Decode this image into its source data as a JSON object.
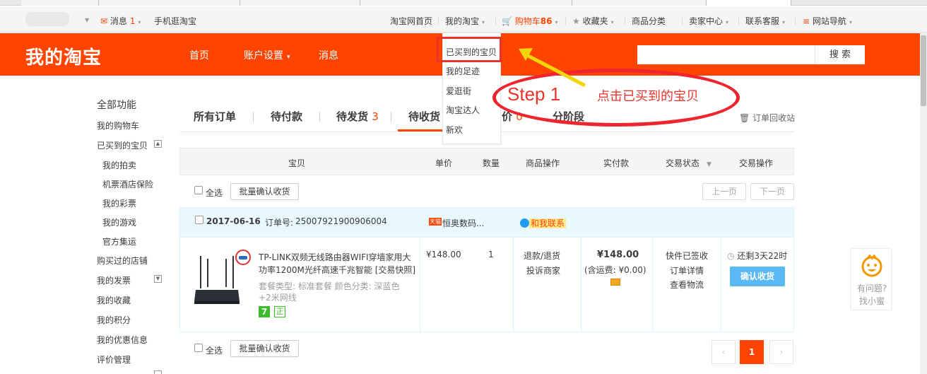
{
  "topbar": {
    "message": "消息",
    "message_count": "1",
    "mobile": "手机逛淘宝",
    "home": "淘宝网首页",
    "my_taobao": "我的淘宝",
    "cart": "购物车",
    "cart_count": "86",
    "favorites": "收藏夹",
    "categories": "商品分类",
    "seller": "卖家中心",
    "service": "联系客服",
    "sitenav": "网站导航"
  },
  "header": {
    "logo": "我的淘宝",
    "nav": [
      "首页",
      "账户设置",
      "消息"
    ],
    "search_button": "搜 索",
    "search_placeholder": ""
  },
  "dropdown": {
    "items": [
      "已买到的宝贝",
      "我的足迹",
      "爱逛街",
      "淘宝达人",
      "新欢"
    ]
  },
  "annotation": {
    "step": "Step 1",
    "text": "点击已买到的宝贝"
  },
  "sidebar": {
    "title": "全部功能",
    "items": [
      "我的购物车",
      "已买到的宝贝",
      "我的拍卖",
      "机票酒店保险",
      "我的彩票",
      "我的游戏",
      "官方集运",
      "购买过的店铺",
      "我的发票",
      "我的收藏",
      "我的积分",
      "我的优惠信息",
      "评价管理"
    ]
  },
  "tabs": {
    "all": "所有订单",
    "unpaid": "待付款",
    "unshipped": "待发货",
    "unshipped_count": "3",
    "unreceived": "待收货",
    "review_partial": "价",
    "review_count": "0",
    "stage": "分阶段",
    "recycle": "订单回收站"
  },
  "table": {
    "headers": [
      "宝贝",
      "单价",
      "数量",
      "商品操作",
      "实付款",
      "交易状态",
      "交易操作"
    ],
    "select_all": "全选",
    "batch_confirm": "批量确认收货",
    "prev": "上一页",
    "next": "下一页"
  },
  "order": {
    "date": "2017-06-16",
    "order_no_label": "订单号:",
    "order_no": "25007921900906004",
    "shop": "恒奥数码...",
    "contact": "和我联系",
    "shop_badge": "天猫",
    "title_1": "TP-LINK双频无线路由器WIFI穿墙家用大",
    "title_2": "功率1200M光纤高速千兆智能 [交易快照]",
    "sku_1": "套餐类型: 标准套餐  颜色分类: 深蓝色",
    "sku_2": "+2米网线",
    "tag_1": "7",
    "tag_2": "正",
    "price": "¥148.00",
    "qty": "1",
    "op_1": "退款/退货",
    "op_2": "投诉商家",
    "paid": "¥148.00",
    "shipping": "(含运费: ¥0.00)",
    "status_1": "快件已签收",
    "status_2": "订单详情",
    "status_3": "查看物流",
    "remaining": "还剩3天22时",
    "confirm": "确认收货"
  },
  "helper": {
    "line1": "有问题?",
    "line2": "找小蜜"
  },
  "pagination": {
    "current": "1"
  }
}
